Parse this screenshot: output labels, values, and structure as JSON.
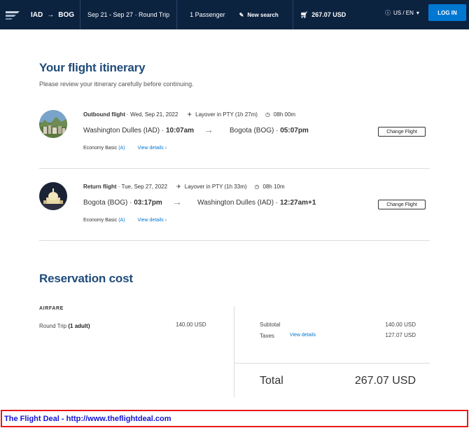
{
  "header": {
    "origin": "IAD",
    "destination": "BOG",
    "dates": "Sep 21 - Sep 27 · Round Trip",
    "passengers": "1 Passenger",
    "new_search": "New search",
    "cart_total": "267.07 USD",
    "locale": "US / EN",
    "login": "LOG IN"
  },
  "page": {
    "title": "Your flight itinerary",
    "subtitle": "Please review your itinerary carefully before continuing."
  },
  "flights": [
    {
      "label": "Outbound flight",
      "date": " · Wed, Sep 21, 2022",
      "layover": "Layover in PTY (1h 27m)",
      "duration": "08h 00m",
      "depart_place": "Washington Dulles (IAD) · ",
      "depart_time": "10:07am",
      "arrive_place": "Bogota (BOG) · ",
      "arrive_time": "05:07pm",
      "fare_class": "Economy Basic",
      "fare_code": "(A)",
      "details": "View details",
      "change": "Change Flight"
    },
    {
      "label": "Return flight",
      "date": " · Tue, Sep 27, 2022",
      "layover": "Layover in PTY (1h 33m)",
      "duration": "08h 10m",
      "depart_place": "Bogota (BOG) · ",
      "depart_time": "03:17pm",
      "arrive_place": "Washington Dulles (IAD) · ",
      "arrive_time": "12:27am+1",
      "fare_class": "Economy Basic",
      "fare_code": "(A)",
      "details": "View details",
      "change": "Change Flight"
    }
  ],
  "reservation": {
    "title": "Reservation cost",
    "airfare_label": "AIRFARE",
    "round_trip_label": "Round Trip",
    "round_trip_qty": "(1 adult)",
    "round_trip_value": "140.00 USD",
    "subtotal_label": "Subtotal",
    "subtotal_value": "140.00 USD",
    "taxes_label": "Taxes",
    "taxes_details": "View details",
    "taxes_value": "127.07 USD",
    "total_label": "Total",
    "total_value": "267.07 USD"
  },
  "banner": {
    "text": "The Flight Deal - http://www.theflightdeal.com"
  },
  "colors": {
    "header_bg": "#0c2340",
    "accent": "#0078d2",
    "title": "#1f4b7a",
    "banner_border": "#e8191a",
    "banner_text": "#1414d8"
  },
  "icons": [
    "logo-icon",
    "arrow-right-icon",
    "pencil-icon",
    "cart-icon",
    "info-icon",
    "chevron-down-icon",
    "plane-icon",
    "clock-icon",
    "chevron-right-icon"
  ]
}
